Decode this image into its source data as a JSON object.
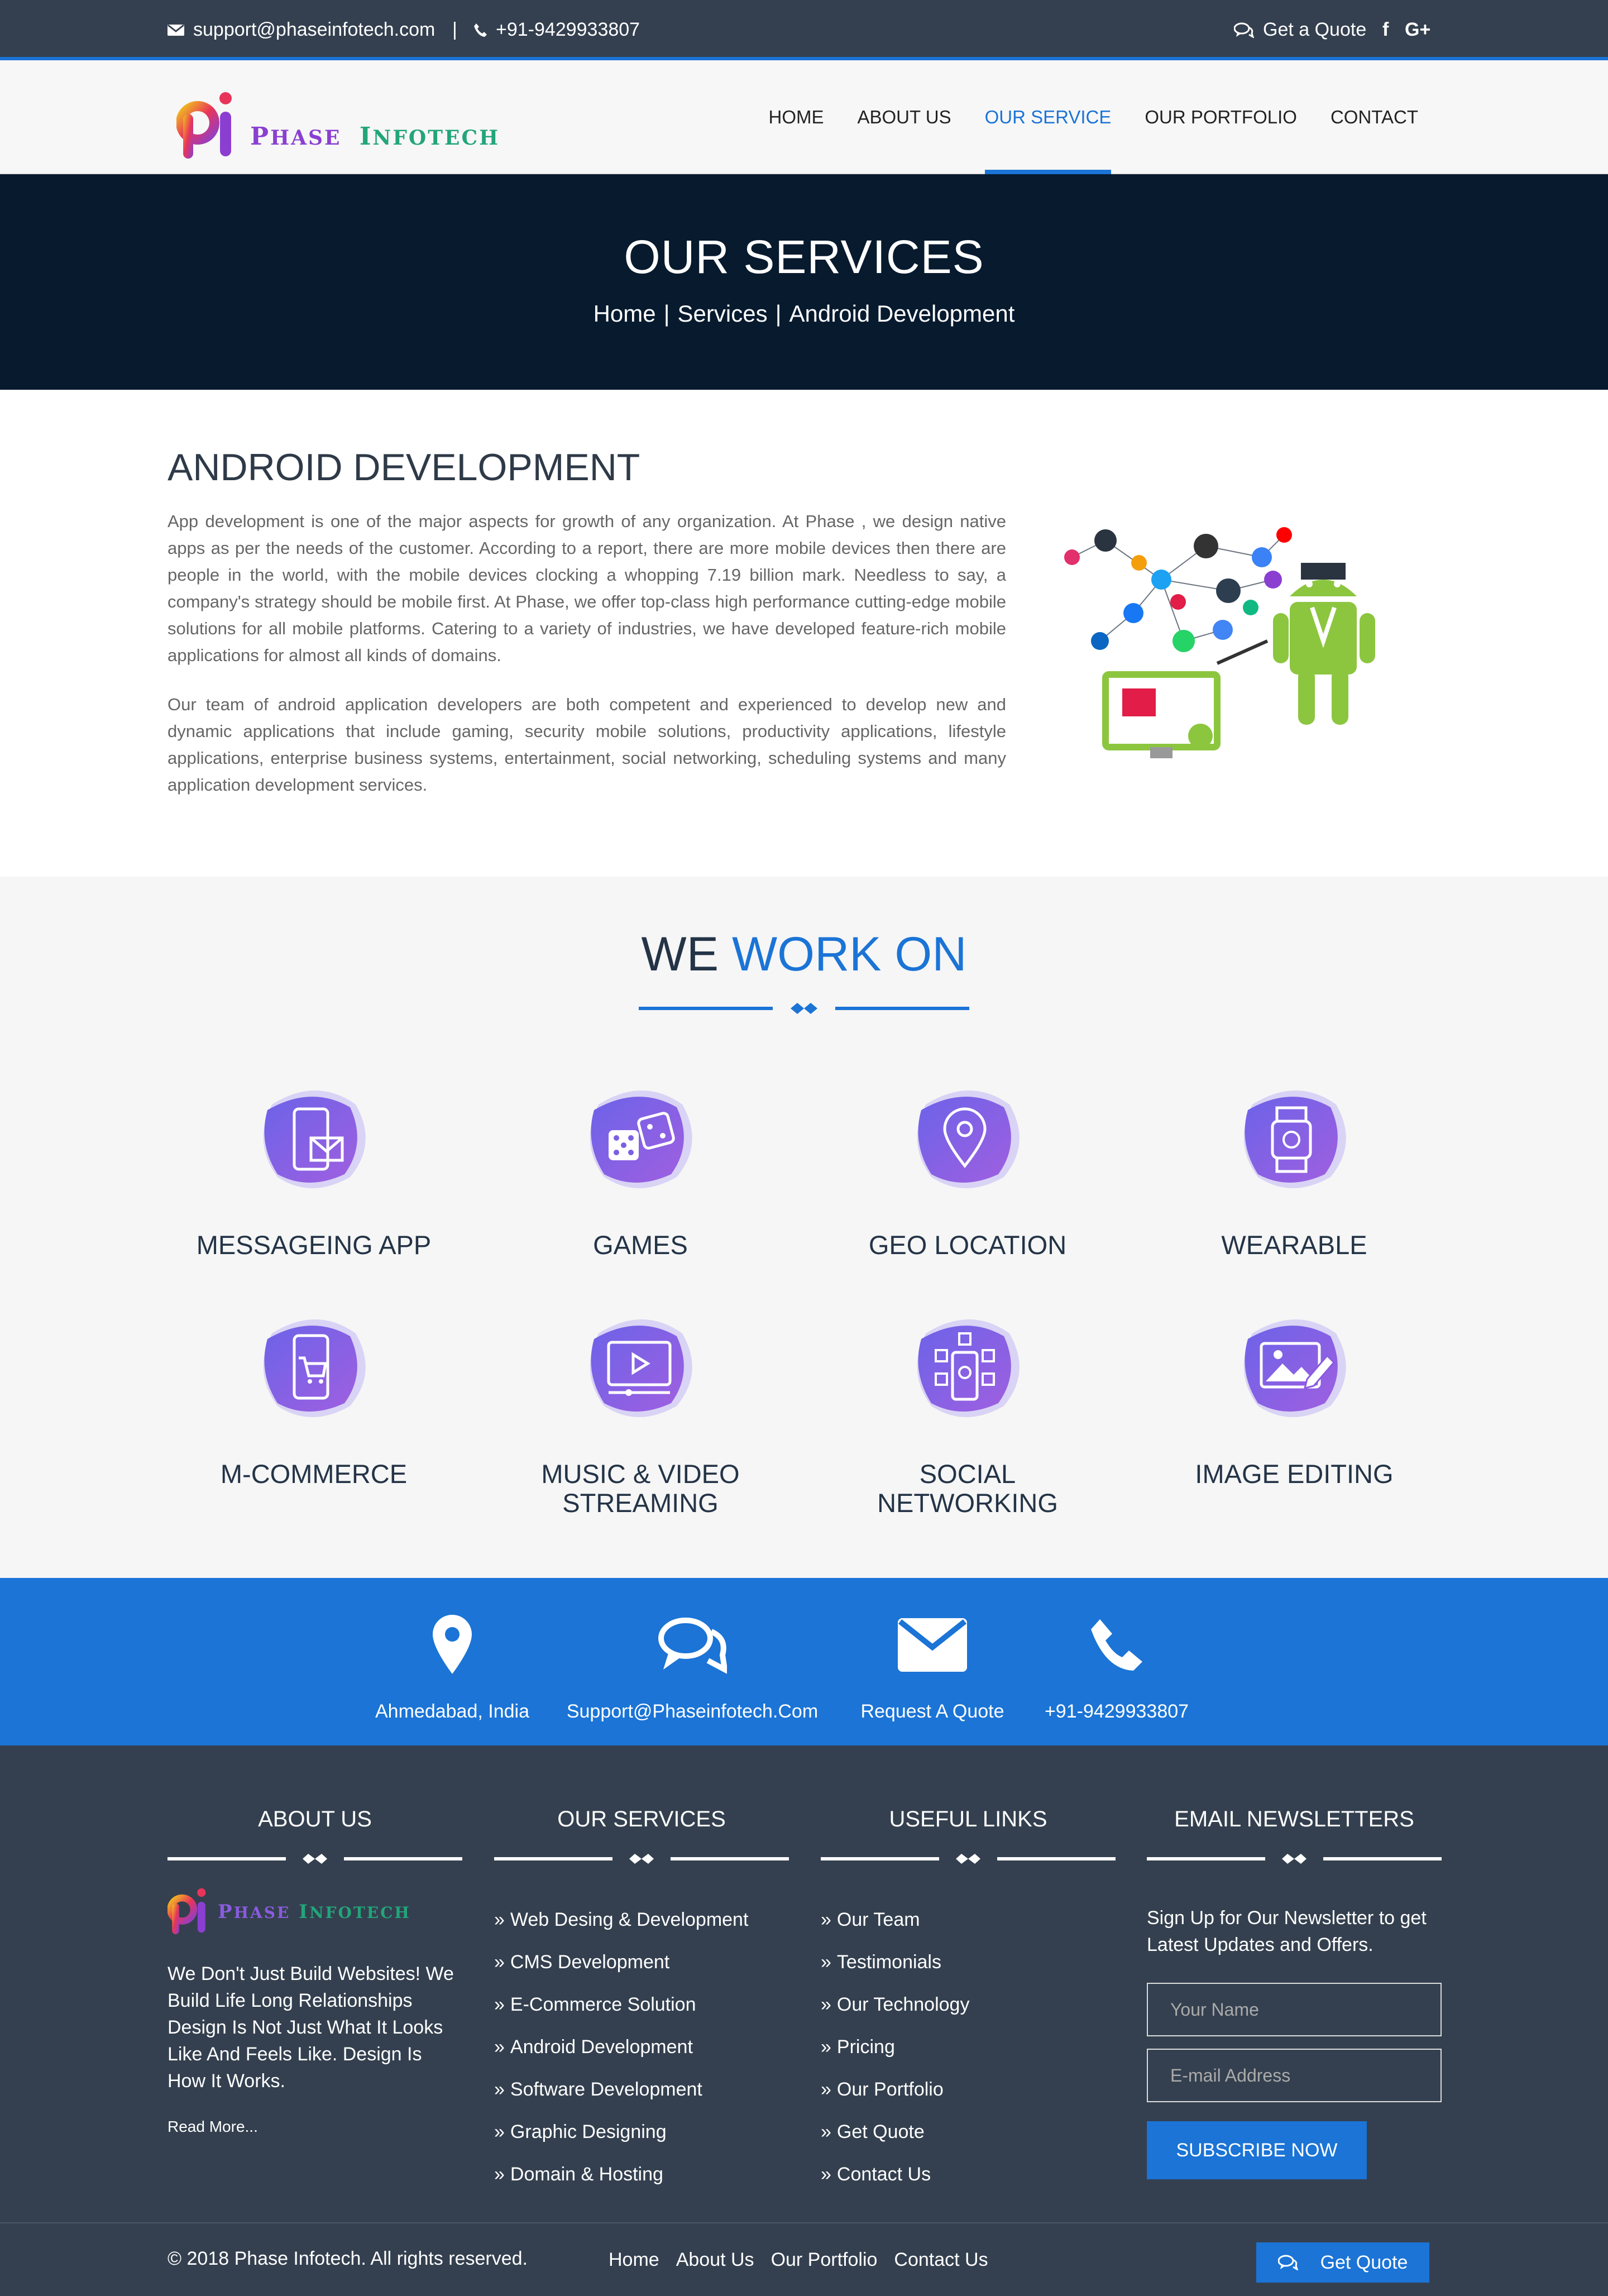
{
  "topbar": {
    "email": "support@phaseinfotech.com",
    "phone": "+91-9429933807",
    "quote": "Get a Quote",
    "social": [
      "facebook-icon",
      "google-plus-icon"
    ]
  },
  "header": {
    "logo_text": "Phase Infotech",
    "nav": [
      "HOME",
      "ABOUT US",
      "OUR SERVICE",
      "OUR PORTFOLIO",
      "CONTACT"
    ],
    "active_nav": "OUR SERVICE"
  },
  "banner": {
    "title": "OUR SERVICES",
    "crumb1": "Home",
    "crumb2": "Services",
    "crumb3": "Android Development"
  },
  "android": {
    "title": "ANDROID DEVELOPMENT",
    "p1": "App development is one of the major aspects for growth of any organization. At Phase , we design native apps as per the needs of the customer. According to a report, there are more mobile devices then there are people in the world, with the mobile devices clocking a whopping 7.19 billion mark. Needless to say, a company's strategy should be mobile first. At Phase, we offer top-class high performance cutting-edge mobile solutions for all mobile platforms. Catering to a variety of industries, we have developed feature-rich mobile applications for almost all kinds of domains.",
    "p2": "Our team of android application developers are both competent and experienced to develop new and dynamic applications that include gaming, security mobile solutions, productivity applications, lifestyle applications, enterprise business systems, entertainment, social networking, scheduling systems and many application development services."
  },
  "work": {
    "title_a": "WE",
    "title_b": "WORK ON",
    "items": [
      "MESSAGEING APP",
      "GAMES",
      "GEO LOCATION",
      "WEARABLE",
      "M-COMMERCE",
      "MUSIC & VIDEO STREAMING",
      "SOCIAL NETWORKING",
      "IMAGE EDITING"
    ]
  },
  "strip": {
    "location": "Ahmedabad, India",
    "email": "Support@Phaseinfotech.Com",
    "quote": "Request A Quote",
    "phone": "+91-9429933807"
  },
  "footer": {
    "about_title": "ABOUT US",
    "about_text": "We Don't Just Build Websites! We Build Life Long Relationships Design Is Not Just What It Looks Like And Feels Like. Design Is How It Works.",
    "read_more": "Read More...",
    "services_title": "OUR SERVICES",
    "services": [
      "Web Desing & Development",
      "CMS Development",
      "E-Commerce Solution",
      "Android Development",
      "Software Development",
      "Graphic Designing",
      "Domain & Hosting"
    ],
    "links_title": "USEFUL LINKS",
    "links": [
      "Our Team",
      "Testimonials",
      "Our Technology",
      "Pricing",
      "Our Portfolio",
      "Get Quote",
      "Contact Us"
    ],
    "news_title": "EMAIL NEWSLETTERS",
    "news_text": "Sign Up for Our Newsletter to get Latest Updates and Offers.",
    "name_placeholder": "Your Name",
    "email_placeholder": "E-mail Address",
    "subscribe": "SUBSCRIBE NOW"
  },
  "copyright": {
    "text": "© 2018 Phase Infotech. All rights reserved.",
    "links": [
      "Home",
      "About Us",
      "Our Portfolio",
      "Contact Us"
    ],
    "quote": "Get Quote"
  },
  "colors": {
    "accent": "#1b74d6",
    "dark": "#34404f",
    "banner": "#071a2e",
    "purple": "#8a5be0"
  }
}
